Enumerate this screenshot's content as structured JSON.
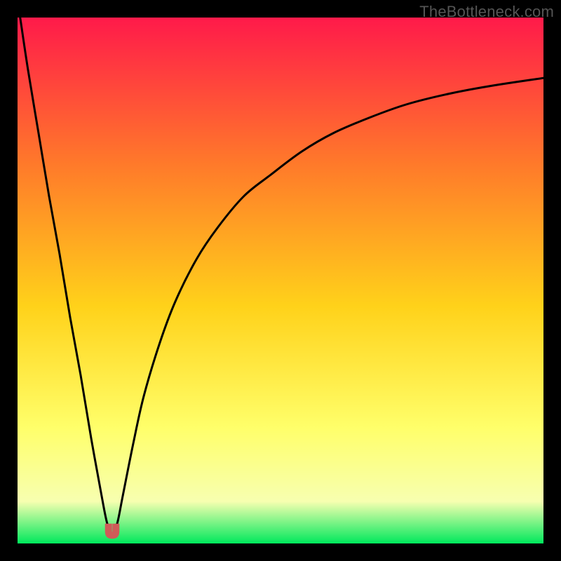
{
  "watermark": "TheBottleneck.com",
  "colors": {
    "frame": "#000000",
    "curve": "#000000",
    "marker_fill": "#cf5b58",
    "marker_stroke": "#cf5b58",
    "grad_top": "#ff1a4a",
    "grad_mid1": "#ff7a2a",
    "grad_mid2": "#ffd21a",
    "grad_mid3": "#ffff6a",
    "grad_mid4": "#f7ffb0",
    "grad_bottom": "#00e85c"
  },
  "chart_data": {
    "type": "line",
    "title": "",
    "xlabel": "",
    "ylabel": "",
    "xlim": [
      0,
      100
    ],
    "ylim": [
      0,
      100
    ],
    "description": "Bottleneck percentage curve with a sharp minimum near x≈18, rising steeply on the left edge and asymptotically toward ~88 on the right. Background is a vertical rainbow gradient from red (top / high bottleneck) to green (bottom / low bottleneck).",
    "series": [
      {
        "name": "bottleneck-curve",
        "x": [
          0.5,
          2,
          4,
          6,
          8,
          10,
          12,
          14,
          16,
          17,
          18,
          19,
          20,
          22,
          24,
          27,
          30,
          34,
          38,
          43,
          48,
          54,
          60,
          67,
          74,
          82,
          90,
          100
        ],
        "y": [
          100,
          90,
          78,
          66,
          55,
          43,
          32,
          20,
          9,
          4,
          1.5,
          4,
          9,
          19,
          28,
          38,
          46,
          54,
          60,
          66,
          70,
          74.5,
          78,
          81,
          83.5,
          85.5,
          87,
          88.5
        ]
      }
    ],
    "marker": {
      "x": 18,
      "y": 1.5,
      "width_x": 2.6,
      "depth_y": 2.2
    }
  }
}
